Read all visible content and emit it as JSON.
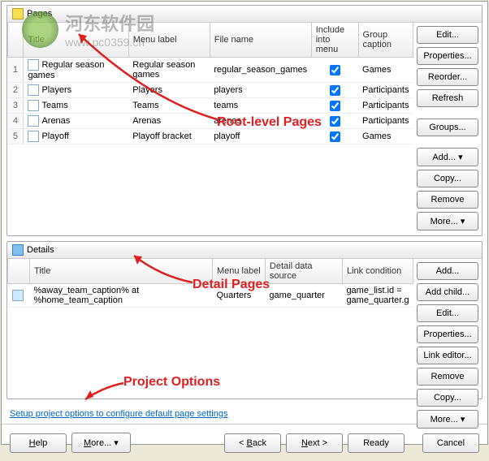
{
  "watermark": {
    "cn": "河东软件园",
    "url": "www.pc0359.cn"
  },
  "pages": {
    "title": "Pages",
    "headers": {
      "row": "",
      "title": "Title",
      "menu": "Menu label",
      "file": "File name",
      "include": "Include into menu",
      "group": "Group caption"
    },
    "rows": [
      {
        "n": "1",
        "title": "Regular season games",
        "menu": "Regular season games",
        "file": "regular_season_games",
        "inc": true,
        "group": "Games"
      },
      {
        "n": "2",
        "title": "Players",
        "menu": "Players",
        "file": "players",
        "inc": true,
        "group": "Participants"
      },
      {
        "n": "3",
        "title": "Teams",
        "menu": "Teams",
        "file": "teams",
        "inc": true,
        "group": "Participants"
      },
      {
        "n": "4",
        "title": "Arenas",
        "menu": "Arenas",
        "file": "arenas",
        "inc": true,
        "group": "Participants"
      },
      {
        "n": "5",
        "title": "Playoff",
        "menu": "Playoff bracket",
        "file": "playoff",
        "inc": true,
        "group": "Games"
      }
    ],
    "buttons": {
      "edit": "Edit...",
      "props": "Properties...",
      "reorder": "Reorder...",
      "refresh": "Refresh",
      "groups": "Groups...",
      "add": "Add... ▾",
      "copy": "Copy...",
      "remove": "Remove",
      "more": "More... ▾"
    }
  },
  "details": {
    "title": "Details",
    "headers": {
      "title": "Title",
      "menu": "Menu label",
      "source": "Detail data source",
      "link": "Link condition"
    },
    "rows": [
      {
        "title": "%away_team_caption% at %home_team_caption",
        "menu": "Quarters",
        "source": "game_quarter",
        "link": "game_list.id = game_quarter.g"
      }
    ],
    "buttons": {
      "add": "Add...",
      "addchild": "Add child...",
      "edit": "Edit...",
      "props": "Properties...",
      "linkeditor": "Link editor...",
      "remove": "Remove",
      "copy": "Copy...",
      "more": "More... ▾"
    }
  },
  "footer_link": "Setup project options to configure default page settings",
  "wizard": {
    "help": "Help",
    "more": "More... ▾",
    "back": "< Back",
    "next": "Next >",
    "ready": "Ready",
    "cancel": "Cancel"
  },
  "annotations": {
    "root": "Root-level Pages",
    "detail": "Detail Pages",
    "project": "Project Options"
  }
}
